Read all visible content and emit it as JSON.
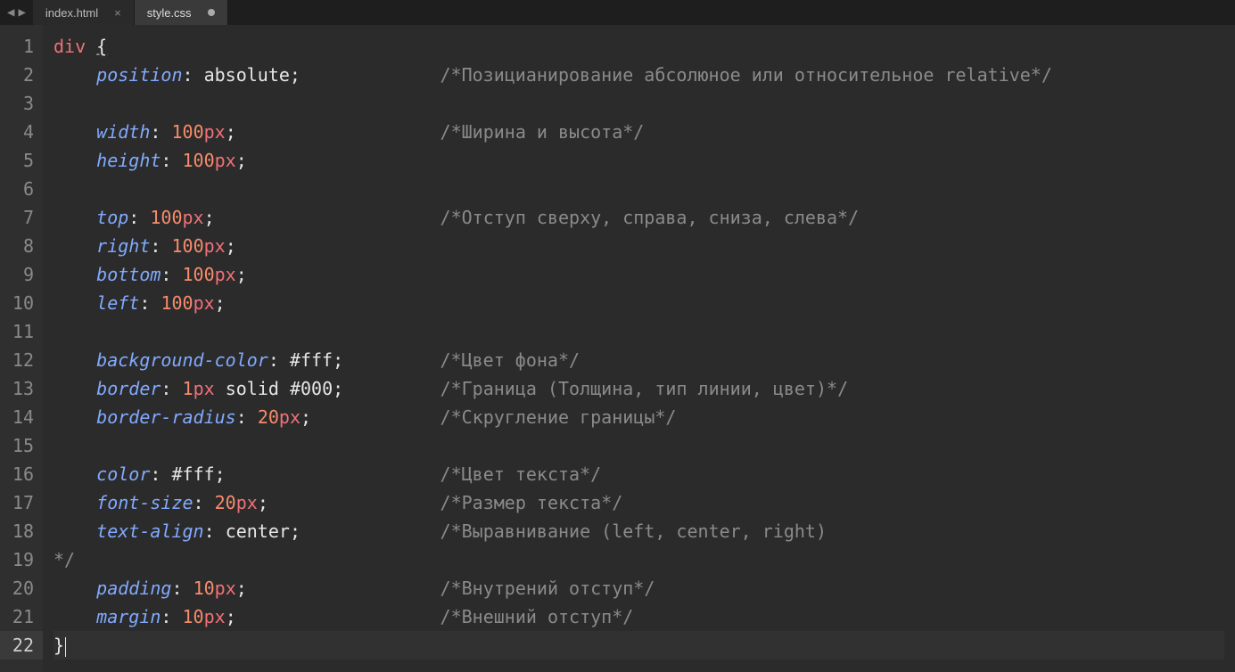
{
  "nav": {
    "left": "◀",
    "right": "▶"
  },
  "tabs": [
    {
      "label": "index.html",
      "active": false,
      "dirty": false
    },
    {
      "label": "style.css",
      "active": true,
      "dirty": true
    }
  ],
  "gutter": [
    "1",
    "2",
    "3",
    "4",
    "5",
    "6",
    "7",
    "8",
    "9",
    "10",
    "11",
    "12",
    "13",
    "14",
    "15",
    "16",
    "17",
    "18",
    "19",
    "20",
    "21",
    "22"
  ],
  "active_line": 22,
  "code": {
    "l1": {
      "sel": "div",
      "brace": "{"
    },
    "l2": {
      "prop": "position",
      "val": "absolute",
      "comm": "/*Позицианирование абсолюное или относительное relative*/"
    },
    "l4": {
      "prop": "width",
      "num": "100",
      "unit": "px",
      "comm": "/*Ширина и высота*/"
    },
    "l5": {
      "prop": "height",
      "num": "100",
      "unit": "px"
    },
    "l7": {
      "prop": "top",
      "num": "100",
      "unit": "px",
      "comm": "/*Отступ сверху, справа, сниза, слева*/"
    },
    "l8": {
      "prop": "right",
      "num": "100",
      "unit": "px"
    },
    "l9": {
      "prop": "bottom",
      "num": "100",
      "unit": "px"
    },
    "l10": {
      "prop": "left",
      "num": "100",
      "unit": "px"
    },
    "l12": {
      "prop": "background-color",
      "val": "#fff",
      "comm": "/*Цвет фона*/"
    },
    "l13": {
      "prop": "border",
      "num": "1",
      "unit": "px",
      "kw": "solid",
      "val": "#000",
      "comm": "/*Граница (Толщина, тип линии, цвет)*/"
    },
    "l14": {
      "prop": "border-radius",
      "num": "20",
      "unit": "px",
      "comm": "/*Скругление границы*/"
    },
    "l16": {
      "prop": "color",
      "val": "#fff",
      "comm": "/*Цвет текста*/"
    },
    "l17": {
      "prop": "font-size",
      "num": "20",
      "unit": "px",
      "comm": "/*Размер текста*/"
    },
    "l18": {
      "prop": "text-align",
      "val": "center",
      "comm": "/*Выравнивание (left, center, right)"
    },
    "l19": {
      "comm": "*/"
    },
    "l20": {
      "prop": "padding",
      "num": "10",
      "unit": "px",
      "comm": "/*Внутрений отступ*/"
    },
    "l21": {
      "prop": "margin",
      "num": "10",
      "unit": "px",
      "comm": "/*Внешний отступ*/"
    },
    "l22": {
      "brace": "}"
    }
  },
  "indent": "    ",
  "comment_col": 36
}
